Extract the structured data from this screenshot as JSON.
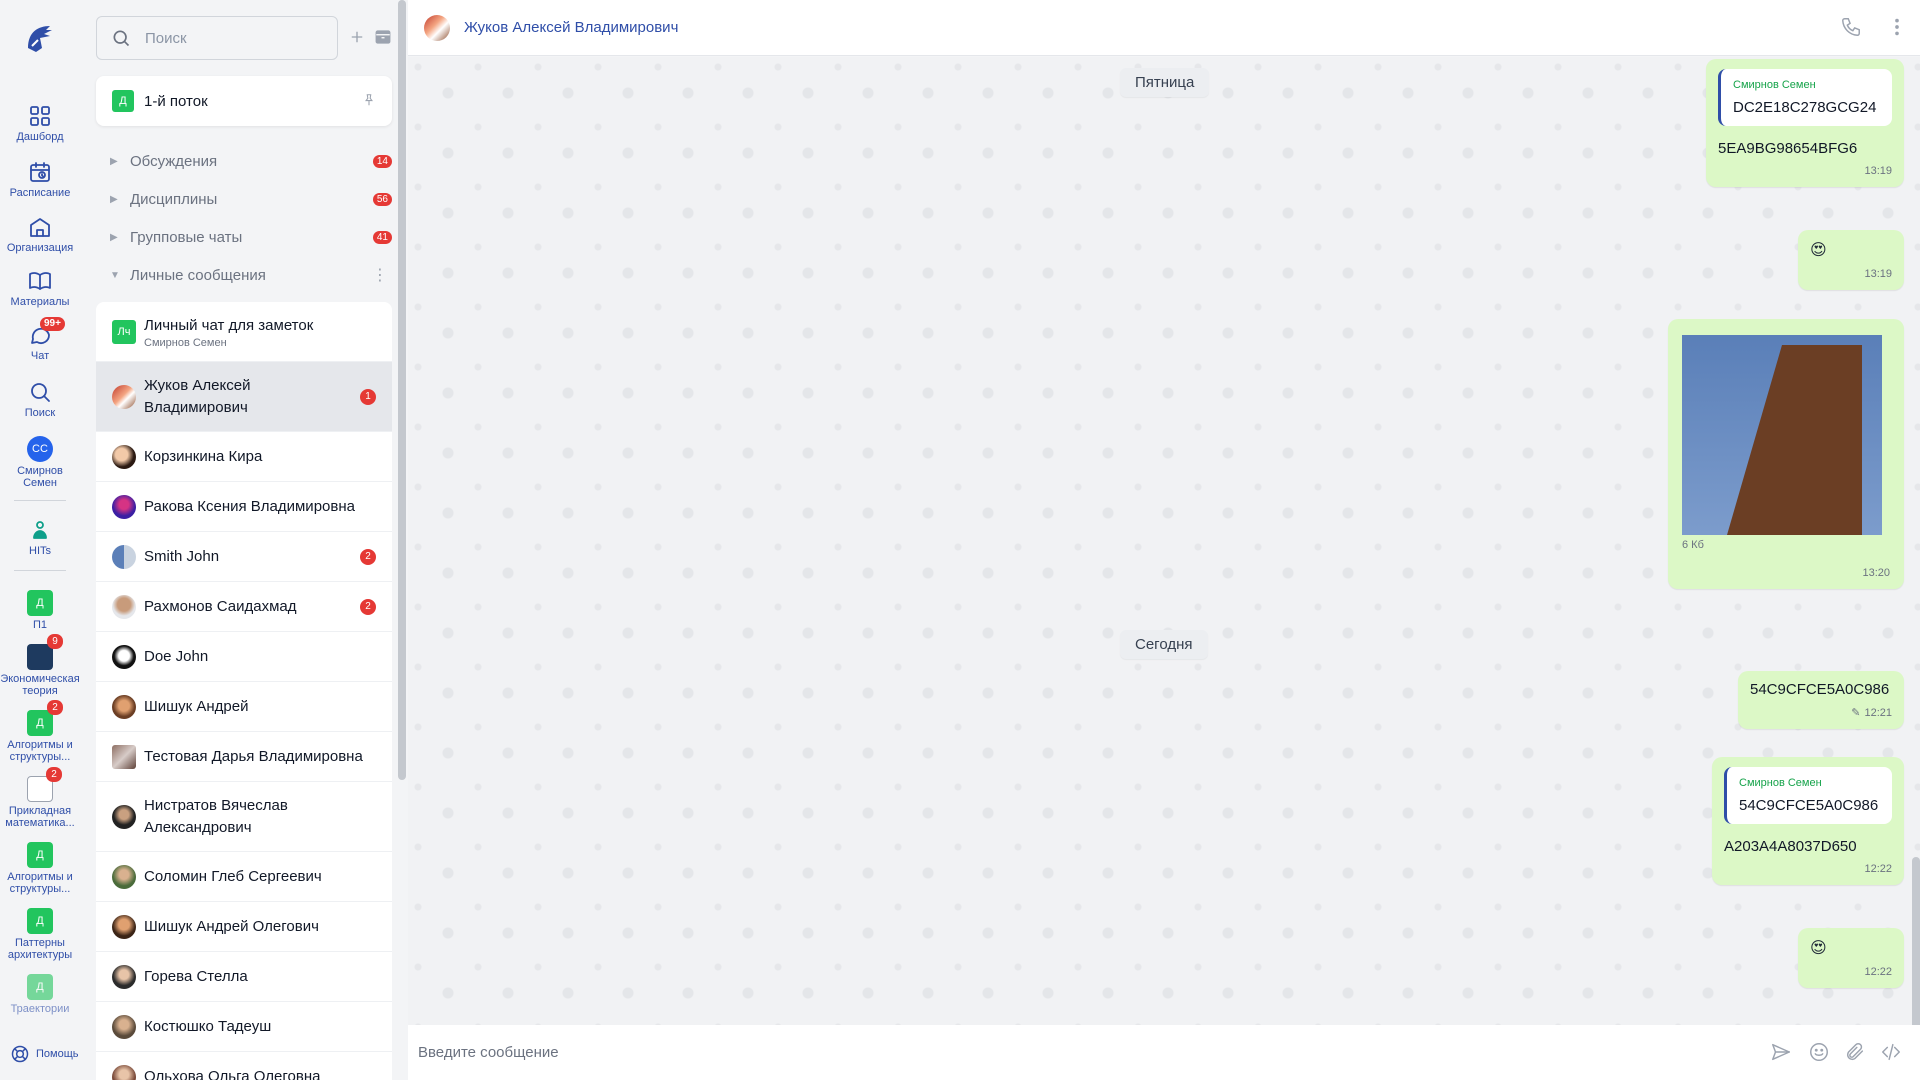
{
  "rail": {
    "logo_icon": "spartan-helmet-logo",
    "items": [
      {
        "label": "Дашборд",
        "icon": "dashboard-icon"
      },
      {
        "label": "Расписание",
        "icon": "calendar-icon"
      },
      {
        "label": "Организация",
        "icon": "organization-icon"
      },
      {
        "label": "Материалы",
        "icon": "book-icon"
      },
      {
        "label": "Чат",
        "icon": "chat-icon",
        "badge": "99+"
      },
      {
        "label": "Поиск",
        "icon": "search-icon"
      }
    ],
    "user": {
      "initials": "СС",
      "label": "Смирнов Семен"
    },
    "hits": {
      "label": "HITs"
    },
    "courses": [
      {
        "letter": "Д",
        "label": "П1",
        "badge": ""
      },
      {
        "letter": "",
        "label": "Экономическая теория",
        "badge": "9"
      },
      {
        "letter": "Д",
        "label": "Алгоритмы и структуры...",
        "badge": "2"
      },
      {
        "letter": "",
        "label": "Прикладная математика...",
        "badge": "2"
      },
      {
        "letter": "Д",
        "label": "Алгоритмы и структуры...",
        "badge": ""
      },
      {
        "letter": "Д",
        "label": "Паттерны архитектуры",
        "badge": ""
      },
      {
        "letter": "Д",
        "label": "Траектории",
        "badge": ""
      }
    ],
    "help_label": "Помощь"
  },
  "sidebar": {
    "search_placeholder": "Поиск",
    "stream": {
      "letter": "Д",
      "name": "1-й поток"
    },
    "sections": [
      {
        "label": "Обсуждения",
        "badge": "14"
      },
      {
        "label": "Дисциплины",
        "badge": "56"
      },
      {
        "label": "Групповые чаты",
        "badge": "41"
      },
      {
        "label": "Личные сообщения",
        "badge": ""
      }
    ],
    "chats": [
      {
        "name": "Личный чат для заметок",
        "sub": "Смирнов Семен",
        "badge": "",
        "avatar_text": "Лч"
      },
      {
        "name": "Жуков Алексей Владимирович",
        "sub": "",
        "badge": "1"
      },
      {
        "name": "Корзинкина Кира",
        "sub": "",
        "badge": ""
      },
      {
        "name": "Ракова Ксения Владимировна",
        "sub": "",
        "badge": ""
      },
      {
        "name": "Smith John",
        "sub": "",
        "badge": "2"
      },
      {
        "name": "Рахмонов Саидахмад",
        "sub": "",
        "badge": "2"
      },
      {
        "name": "Doe John",
        "sub": "",
        "badge": ""
      },
      {
        "name": "Шишук Андрей",
        "sub": "",
        "badge": ""
      },
      {
        "name": "Тестовая Дарья Владимировна",
        "sub": "",
        "badge": ""
      },
      {
        "name": "Нистратов Вячеслав Александрович",
        "sub": "",
        "badge": ""
      },
      {
        "name": "Соломин Глеб Сергеевич",
        "sub": "",
        "badge": ""
      },
      {
        "name": "Шишук Андрей Олегович",
        "sub": "",
        "badge": ""
      },
      {
        "name": "Горева Стелла",
        "sub": "",
        "badge": ""
      },
      {
        "name": "Костюшко Тадеуш",
        "sub": "",
        "badge": ""
      },
      {
        "name": "Ольхова Ольга Олеговна",
        "sub": "",
        "badge": ""
      }
    ]
  },
  "chat": {
    "title": "Жуков Алексей Владимирович",
    "dates": [
      "Пятница",
      "Сегодня"
    ],
    "messages": [
      {
        "quote_author": "Смирнов Семен",
        "quote_text": "DC2E18C278GCG24",
        "text": "5EA9BG98654BFG6",
        "time": "13:19"
      },
      {
        "emoji": "😍",
        "time": "13:19"
      },
      {
        "image_size": "6 Кб",
        "time": "13:20"
      },
      {
        "text": "54C9CFCE5A0C986",
        "time": "12:21",
        "edited": true
      },
      {
        "quote_author": "Смирнов Семен",
        "quote_text": "54C9CFCE5A0C986",
        "text": "A203A4A8037D650",
        "time": "12:22"
      },
      {
        "emoji": "😍",
        "time": "12:22"
      }
    ],
    "composer_placeholder": "Введите сообщение"
  },
  "colors": {
    "accent": "#2f4ea8",
    "badge": "#e53935",
    "bubble": "#dcf8c6",
    "course": "#22c55e"
  }
}
